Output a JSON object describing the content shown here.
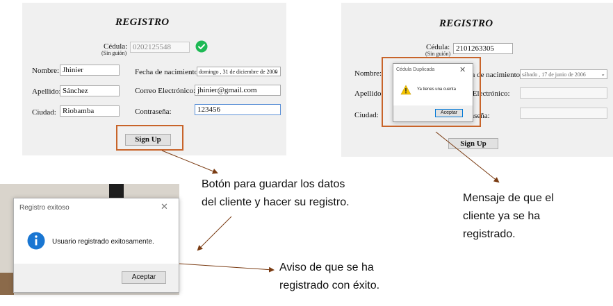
{
  "left_form": {
    "title": "REGISTRO",
    "cedula_label": "Cédula:",
    "cedula_sub": "(Sin guión)",
    "cedula_value": "0202125548",
    "nombre_label": "Nombre:",
    "nombre_value": "Jhinier",
    "apellido_label": "Apellido:",
    "apellido_value": "Sánchez",
    "ciudad_label": "Ciudad:",
    "ciudad_value": "Riobamba",
    "fecha_label": "Fecha de nacimiento:",
    "fecha_value": "domingo , 31 de diciembre de 2000",
    "correo_label": "Correo Electrónico:",
    "correo_value": "jhinier@gmail.com",
    "contrasena_label": "Contraseña:",
    "contrasena_value": "123456",
    "signup_label": "Sign Up"
  },
  "right_form": {
    "title": "REGISTRO",
    "cedula_label": "Cédula:",
    "cedula_sub": "(Sin guión)",
    "cedula_value": "2101263305",
    "nombre_label": "Nombre:",
    "apellido_label": "Apellido:",
    "ciudad_label": "Ciudad:",
    "fecha_label_partial": "ha de nacimiento",
    "fecha_value": "sábado  ,  17  de     junio     de  2006",
    "correo_label_partial": "reo Electrónico:",
    "contrasena_label_partial": "ntraseña:",
    "signup_label": "Sign Up"
  },
  "dialog_duplicate": {
    "title": "Cédula Duplicada",
    "message": "Ya tienes una cuenta",
    "button": "Aceptar"
  },
  "dialog_success": {
    "title": "Registro exitoso",
    "message": "Usuario registrado exitosamente.",
    "button": "Aceptar"
  },
  "annotations": {
    "signup_note": [
      "Botón para guardar los datos",
      "del cliente y hacer su registro."
    ],
    "duplicate_note": [
      "Mensaje de que el",
      "cliente ya se ha",
      "registrado."
    ],
    "success_note": [
      "Aviso de que se ha",
      "registrado con éxito."
    ]
  },
  "colors": {
    "highlight": "#c8642a",
    "check_green": "#1db954",
    "warning_yellow": "#f5c400",
    "info_blue": "#1976d2",
    "arrow": "#7a3b12"
  },
  "icons": {
    "check": "check-circle-icon",
    "warning": "warning-icon",
    "info": "info-icon",
    "close": "close-icon",
    "dropdown": "chevron-down-icon"
  }
}
